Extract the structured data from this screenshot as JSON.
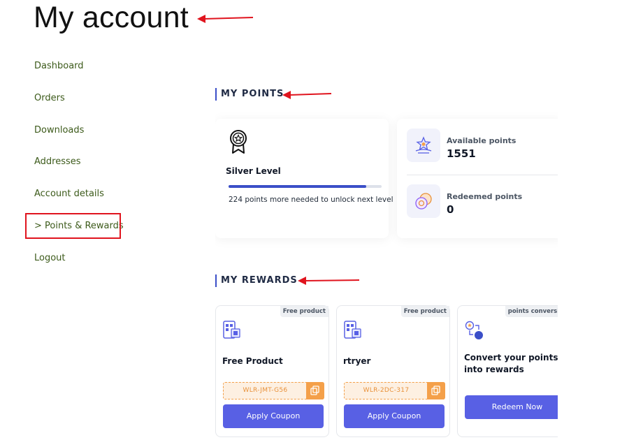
{
  "page": {
    "title": "My account"
  },
  "nav": {
    "items": [
      {
        "label": "Dashboard"
      },
      {
        "label": "Orders"
      },
      {
        "label": "Downloads"
      },
      {
        "label": "Addresses"
      },
      {
        "label": "Account details"
      },
      {
        "label": "> Points & Rewards"
      },
      {
        "label": "Logout"
      }
    ]
  },
  "points_section": {
    "title": "MY POINTS",
    "level": {
      "name": "Silver Level",
      "progress_percent": 90,
      "note": "224 points more needed to unlock next level"
    },
    "available": {
      "label": "Available points",
      "value": "1551"
    },
    "redeemed": {
      "label": "Redeemed points",
      "value": "0"
    }
  },
  "rewards_section": {
    "title": "MY REWARDS",
    "rewards": [
      {
        "badge": "Free product",
        "name": "Free Product",
        "code": "WLR-JMT-G56",
        "button": "Apply Coupon"
      },
      {
        "badge": "Free product",
        "name": "rtryer",
        "code": "WLR-2DC-317",
        "button": "Apply Coupon"
      },
      {
        "badge": "points conversion",
        "name": "Convert your points into rewards",
        "button": "Redeem Now"
      }
    ]
  },
  "colors": {
    "accent": "#5860e4",
    "nav_text": "#3c5a1a",
    "annotation_red": "#e0141e",
    "coupon_orange": "#f4a04a"
  }
}
